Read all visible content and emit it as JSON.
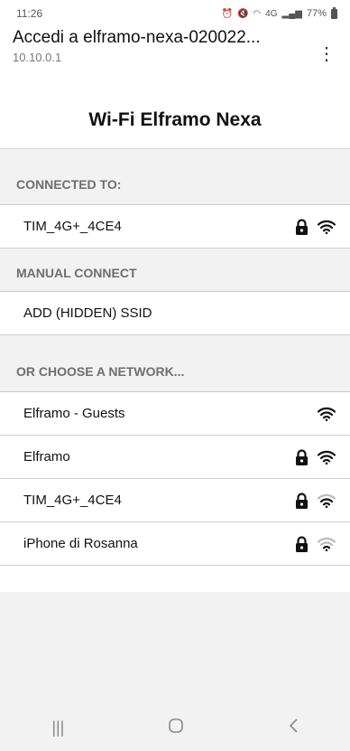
{
  "status": {
    "time": "11:26",
    "battery": "77%",
    "network": "4G"
  },
  "browser": {
    "title": "Accedi a elframo-nexa-020022...",
    "url": "10.10.0.1",
    "menu_icon": "more-vert-icon"
  },
  "page": {
    "title": "Wi-Fi Elframo Nexa"
  },
  "sections": {
    "connected": {
      "heading": "CONNECTED TO:",
      "network": "TIM_4G+_4CE4"
    },
    "manual": {
      "heading": "MANUAL CONNECT",
      "item": "ADD (HIDDEN) SSID"
    },
    "choose": {
      "heading": "OR CHOOSE A NETWORK...",
      "networks": [
        {
          "name": "Elframo - Guests",
          "locked": false,
          "signal": 4
        },
        {
          "name": "Elframo",
          "locked": true,
          "signal": 4
        },
        {
          "name": "TIM_4G+_4CE4",
          "locked": true,
          "signal": 3
        },
        {
          "name": "iPhone di Rosanna",
          "locked": true,
          "signal": 2
        }
      ]
    }
  },
  "colors": {
    "section_bg": "#f2f2f2",
    "section_text": "#6e6e6e",
    "divider": "#cfcfcf"
  }
}
